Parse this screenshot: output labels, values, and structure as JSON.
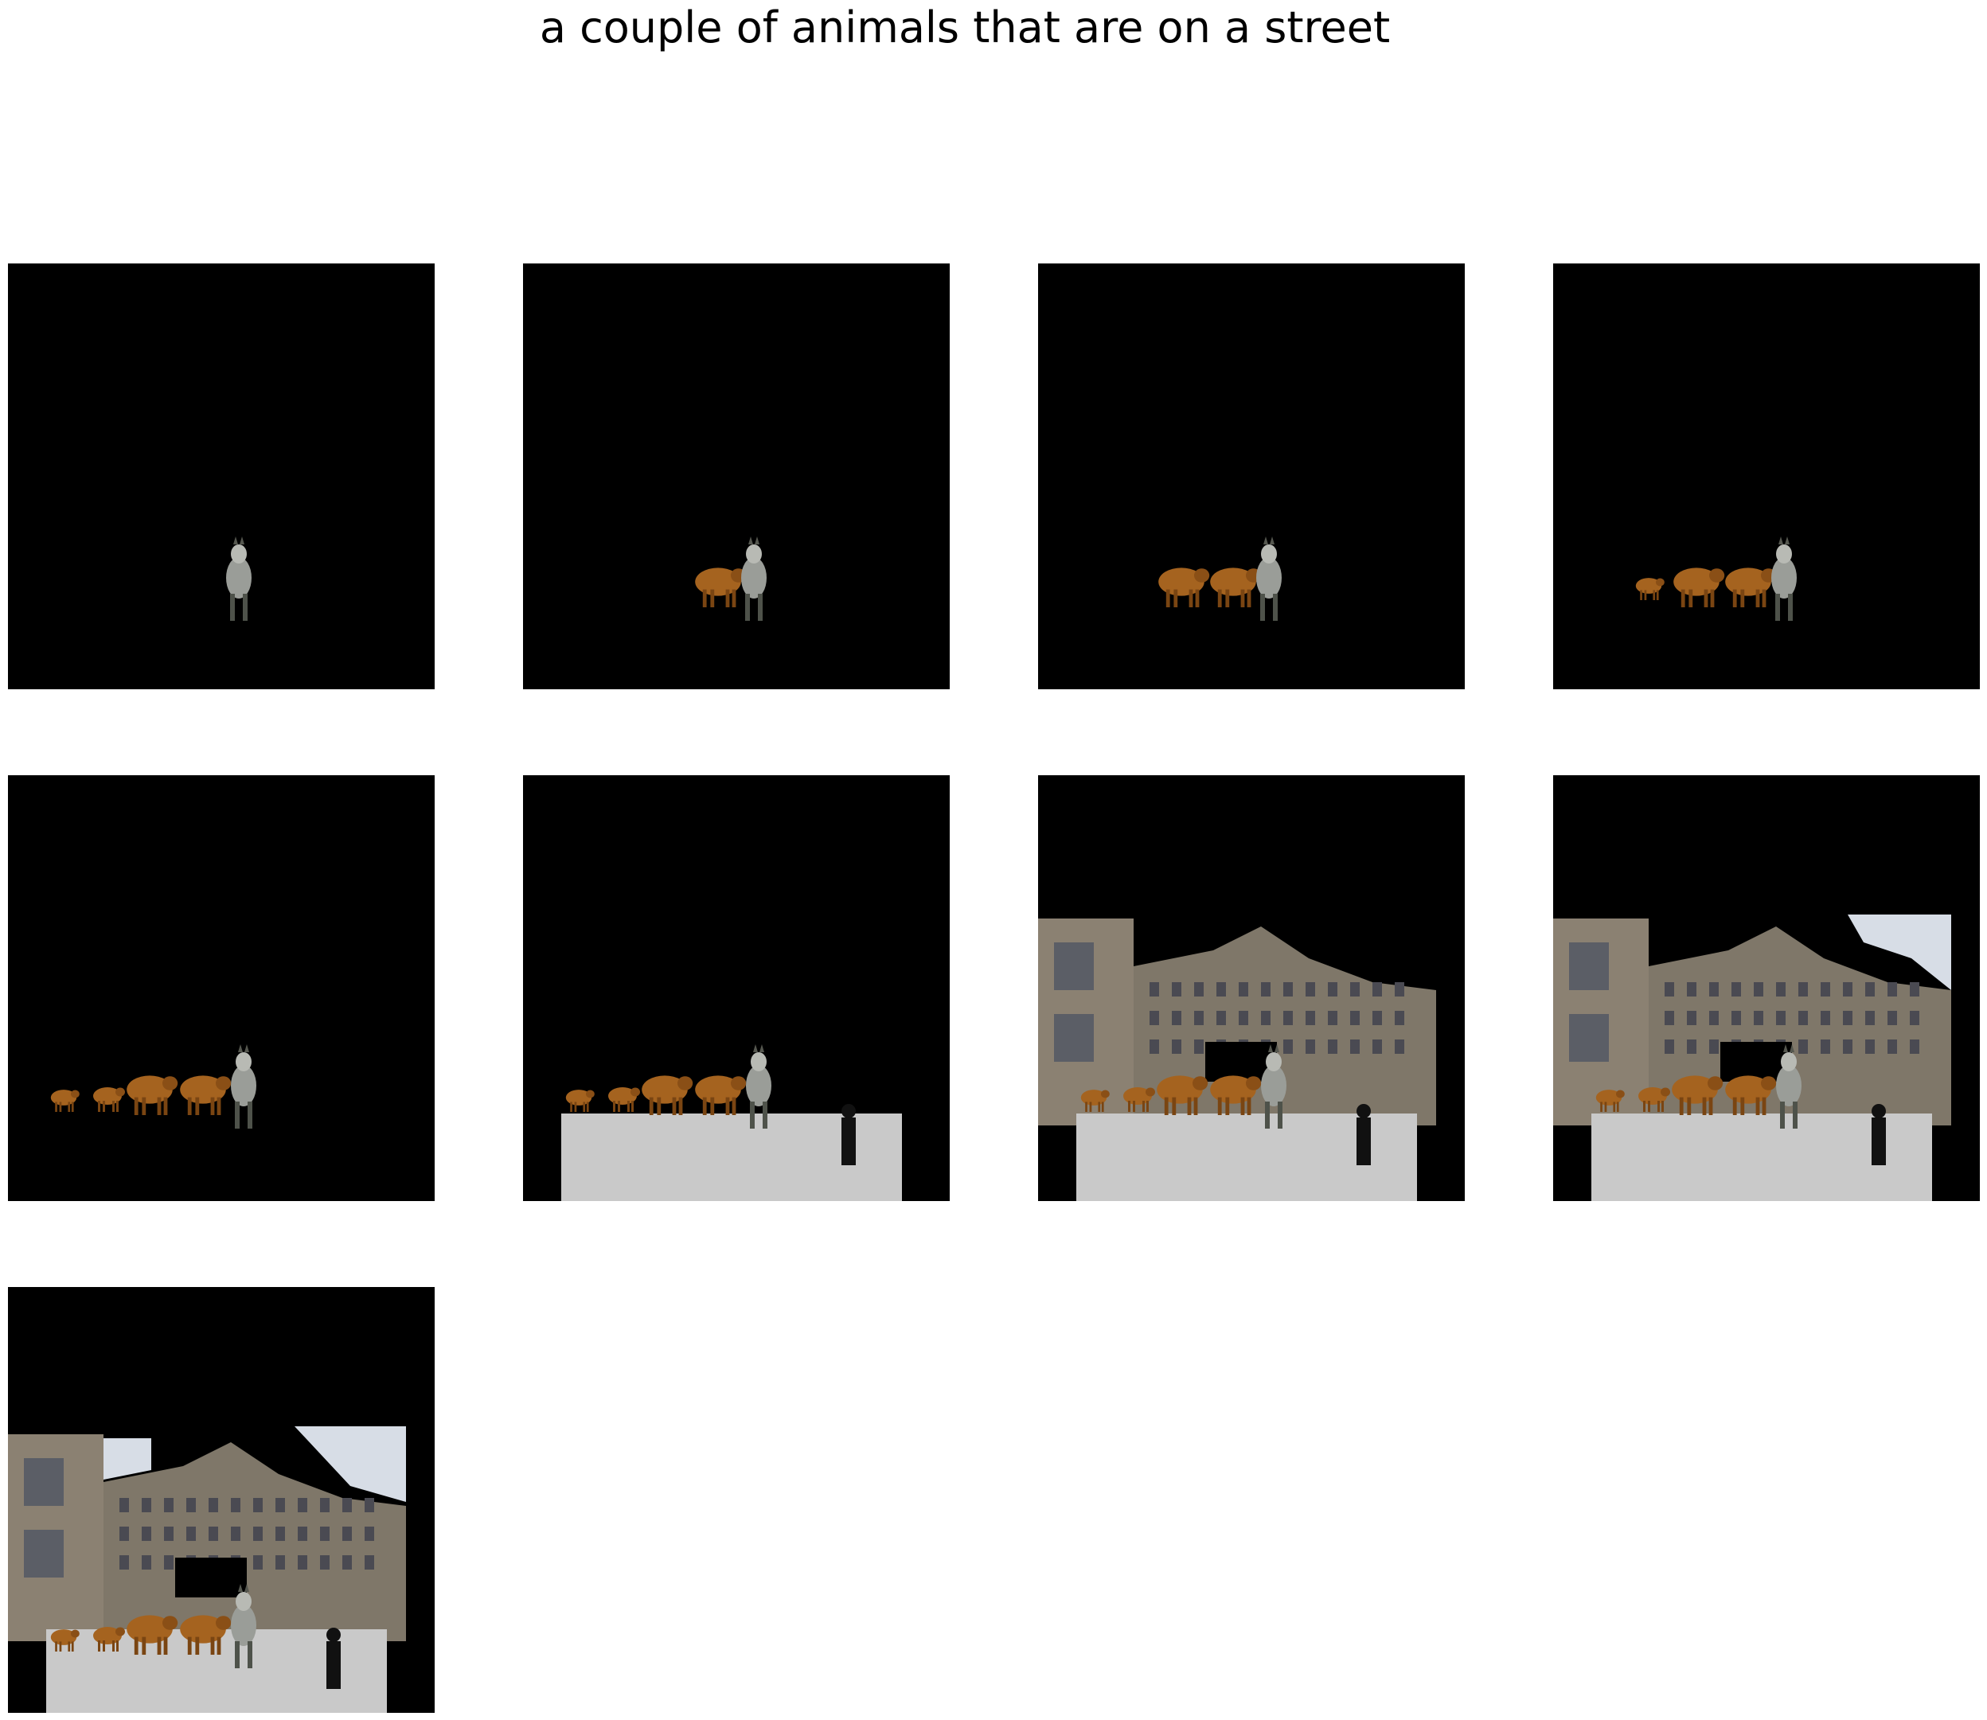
{
  "caption": "a couple of animals that are on a street",
  "panels": [
    {
      "step": 1,
      "layers": [
        "horse"
      ]
    },
    {
      "step": 2,
      "layers": [
        "horse",
        "cow"
      ]
    },
    {
      "step": 3,
      "layers": [
        "horse",
        "cow",
        "cow"
      ]
    },
    {
      "step": 4,
      "layers": [
        "horse",
        "cow",
        "cow",
        "calf"
      ]
    },
    {
      "step": 5,
      "layers": [
        "horse",
        "cow",
        "cow",
        "calf",
        "calf"
      ]
    },
    {
      "step": 6,
      "layers": [
        "horse",
        "cow",
        "cow",
        "calf",
        "calf",
        "street",
        "person"
      ]
    },
    {
      "step": 7,
      "layers": [
        "horse",
        "cow",
        "cow",
        "calf",
        "calf",
        "street",
        "person",
        "buildings"
      ]
    },
    {
      "step": 8,
      "layers": [
        "horse",
        "cow",
        "cow",
        "calf",
        "calf",
        "street",
        "person",
        "buildings",
        "sky"
      ]
    },
    {
      "step": 9,
      "layers": [
        "horse",
        "cow",
        "cow",
        "calf",
        "calf",
        "street",
        "person",
        "buildings",
        "sky"
      ]
    }
  ],
  "colors": {
    "background": "#000000",
    "cow": "#a5631f",
    "horse": "#9a9d98",
    "street": "#c9c9c9",
    "building": "#8b8172",
    "sky": "#d7dde6"
  }
}
